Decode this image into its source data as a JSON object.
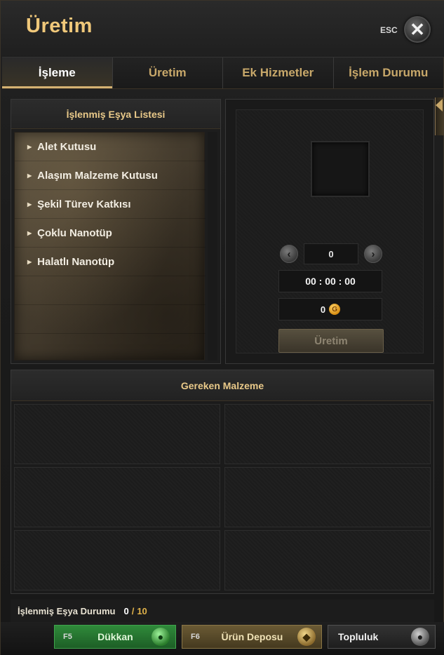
{
  "window": {
    "title": "Üretim",
    "esc_label": "ESC",
    "close_icon": "close-icon"
  },
  "tabs": [
    {
      "label": "İşleme",
      "active": true
    },
    {
      "label": "Üretim",
      "active": false
    },
    {
      "label": "Ek Hizmetler",
      "active": false
    },
    {
      "label": "İşlem Durumu",
      "active": false
    }
  ],
  "item_list": {
    "header": "İşlenmiş Eşya Listesi",
    "items": [
      {
        "label": "Alet Kutusu"
      },
      {
        "label": "Alaşım Malzeme Kutusu"
      },
      {
        "label": "Şekil Türev Katkısı"
      },
      {
        "label": "Çoklu Nanotüp"
      },
      {
        "label": "Halatlı Nanotüp"
      }
    ]
  },
  "craft": {
    "quantity": "0",
    "time": "00 : 00 : 00",
    "gold_cost": "0",
    "gold_icon_glyph": "G",
    "button_label": "Üretim",
    "prev_icon": "chevron-left-icon",
    "next_icon": "chevron-right-icon"
  },
  "materials": {
    "header": "Gereken Malzeme"
  },
  "status": {
    "label": "İşlenmiş Eşya Durumu",
    "count": "0",
    "separator": "/",
    "max": "10"
  },
  "bottom_bar": {
    "shop": {
      "key": "F5",
      "label": "Dükkan",
      "icon": "shop-icon"
    },
    "storage": {
      "key": "F6",
      "label": "Ürün Deposu",
      "icon": "storage-icon"
    },
    "community": {
      "label": "Topluluk",
      "icon": "community-icon"
    }
  },
  "colors": {
    "accent_gold": "#f0c87a",
    "tab_gold": "#c8a86a",
    "shop_green": "#2f8a3a",
    "limit_gold": "#e0b24a"
  }
}
